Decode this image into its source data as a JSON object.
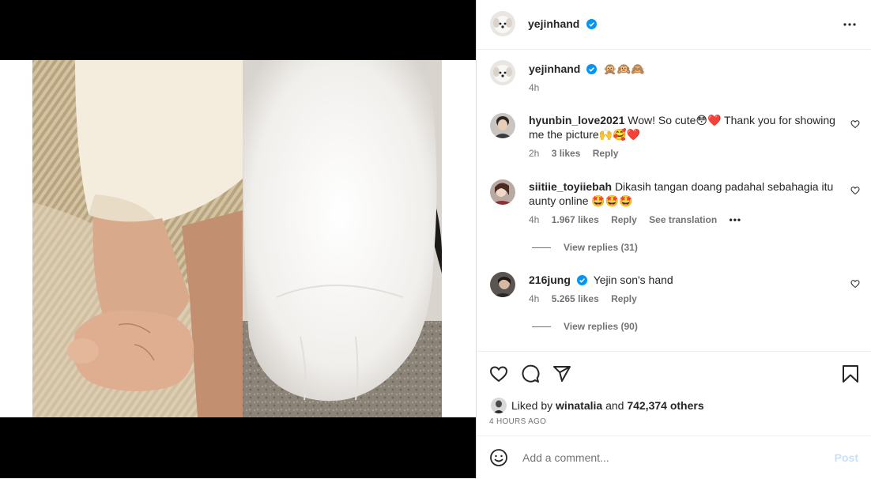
{
  "post": {
    "author": "yejinhand",
    "verified": true
  },
  "caption": {
    "username": "yejinhand",
    "emojis": "🙊🙉🙈",
    "time": "4h"
  },
  "comments": [
    {
      "username": "hyunbin_love2021",
      "text": "Wow! So cute😳❤️ Thank you for showing me the picture🙌🥰❤️",
      "time": "2h",
      "likes": "3 likes",
      "reply": "Reply"
    },
    {
      "username": "siitiie_toyiiebah",
      "text": "Dikasih tangan doang padahal sebahagia itu aunty online 🤩🤩🤩",
      "time": "4h",
      "likes": "1.967 likes",
      "reply": "Reply",
      "translate": "See translation",
      "more": "•••",
      "view_replies": "View replies (31)"
    },
    {
      "username": "216jung",
      "verified": true,
      "text": "Yejin son's hand",
      "time": "4h",
      "likes": "5.265 likes",
      "reply": "Reply",
      "view_replies": "View replies (90)"
    }
  ],
  "likes": {
    "prefix": "Liked by",
    "user": "winatalia",
    "and": "and",
    "others": "742,374 others"
  },
  "timestamp": "4 HOURS AGO",
  "add_comment": {
    "placeholder": "Add a comment...",
    "post_label": "Post"
  },
  "colors": {
    "verified": "#0095f6",
    "post_disabled": "#c7e0fd",
    "text": "#262626",
    "muted": "#737373",
    "like_heart": "#ed4956"
  },
  "icons": [
    "more-icon",
    "heart-icon",
    "comment-icon",
    "share-icon",
    "bookmark-icon",
    "emoji-icon",
    "verified-icon"
  ]
}
